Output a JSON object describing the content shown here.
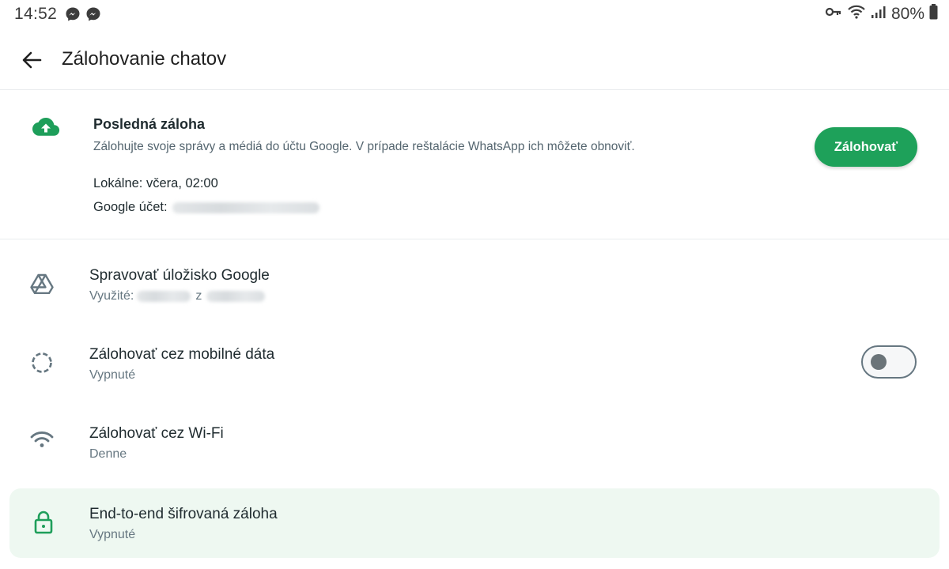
{
  "status_bar": {
    "time": "14:52",
    "notification_icons": [
      "messenger-icon",
      "messenger-icon"
    ],
    "right_icons": [
      "vpn-key-icon",
      "wifi-icon",
      "cellular-signal-icon",
      "battery-icon"
    ],
    "battery_percent": "80%"
  },
  "app_bar": {
    "back_icon": "arrow-back-icon",
    "title": "Zálohovanie chatov"
  },
  "last_backup": {
    "icon": "cloud-upload-icon",
    "title": "Posledná záloha",
    "description": "Zálohujte svoje správy a médiá do účtu Google. V prípade reštalácie WhatsApp ich môžete obnoviť.",
    "local": "Lokálne: včera, 02:00",
    "account_label": "Google účet:",
    "button_label": "Zálohovať"
  },
  "settings": [
    {
      "icon": "google-drive-icon",
      "title": "Spravovať úložisko Google",
      "subtitle_prefix": "Využité:",
      "subtitle_mid": "z"
    },
    {
      "icon": "mobile-data-icon",
      "title": "Zálohovať cez mobilné dáta",
      "subtitle": "Vypnuté",
      "toggle_on": false
    },
    {
      "icon": "wifi-icon",
      "title": "Zálohovať cez Wi-Fi",
      "subtitle": "Denne"
    },
    {
      "icon": "lock-icon",
      "title": "End-to-end šifrovaná záloha",
      "subtitle": "Vypnuté"
    }
  ],
  "colors": {
    "accent_green": "#1ea15a",
    "icon_green": "#1e9e5a",
    "highlight_bg": "#eef8f1",
    "secondary_text": "#667781"
  }
}
